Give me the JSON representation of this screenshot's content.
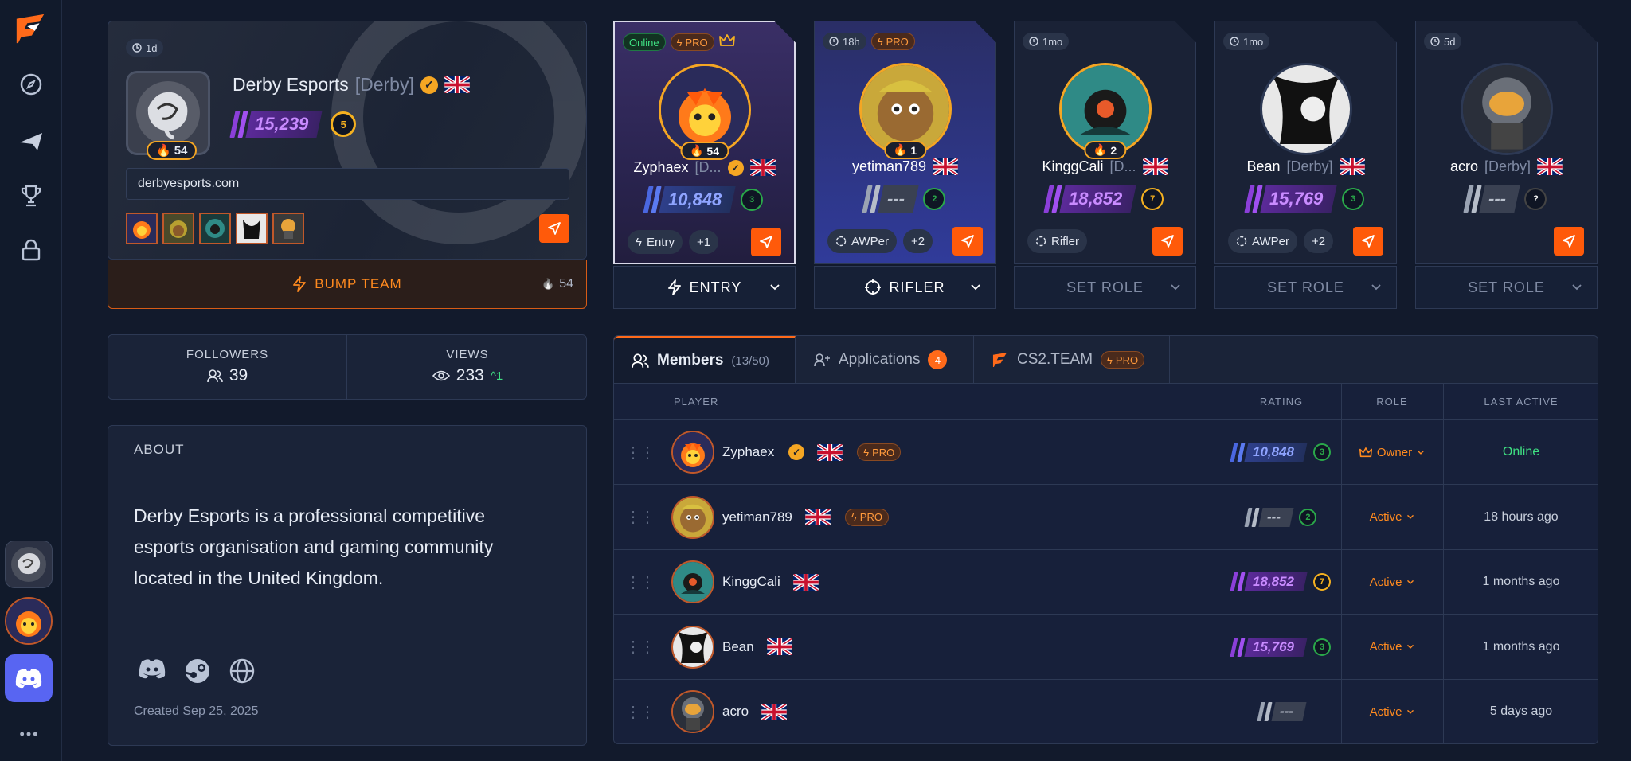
{
  "sidebar": {
    "nav_icons": [
      "logo-icon",
      "compass-icon",
      "megaphone-icon",
      "trophy-icon",
      "lock-icon"
    ],
    "more_label": "•••"
  },
  "team": {
    "age_badge": "1d",
    "name": "Derby Esports",
    "tag": "[Derby]",
    "rating": "15,239",
    "level": "5",
    "fire_count": "54",
    "website": "derbyesports.com",
    "bump_label": "BUMP TEAM",
    "bump_count": "54",
    "followers_label": "FOLLOWERS",
    "followers": "39",
    "views_label": "VIEWS",
    "views": "233",
    "views_delta": "^1"
  },
  "about": {
    "title": "ABOUT",
    "text": "Derby Esports is a professional competitive esports organisation and gaming community located in the United Kingdom.",
    "created": "Created Sep 25, 2025"
  },
  "player_cards": [
    {
      "badge": "Online",
      "pro": "PRO",
      "name": "Zyphaex",
      "tag": "[D...",
      "rating": "10,848",
      "level": "3",
      "fire": "54",
      "role_chip": "Entry",
      "extra": "+1",
      "role": "ENTRY",
      "set": true
    },
    {
      "badge": "18h",
      "pro": "PRO",
      "name": "yetiman789",
      "tag": "",
      "rating": "---",
      "level": "2",
      "fire": "1",
      "role_chip": "AWPer",
      "extra": "+2",
      "role": "RIFLER",
      "set": true
    },
    {
      "badge": "1mo",
      "pro": "",
      "name": "KinggCali",
      "tag": "[D...",
      "rating": "18,852",
      "level": "7",
      "fire": "2",
      "role_chip": "Rifler",
      "extra": "",
      "role": "SET ROLE",
      "set": false
    },
    {
      "badge": "1mo",
      "pro": "",
      "name": "Bean",
      "tag": "[Derby]",
      "rating": "15,769",
      "level": "3",
      "fire": "",
      "role_chip": "AWPer",
      "extra": "+2",
      "role": "SET ROLE",
      "set": false
    },
    {
      "badge": "5d",
      "pro": "",
      "name": "acro",
      "tag": "[Derby]",
      "rating": "---",
      "level": "?",
      "fire": "",
      "role_chip": "",
      "extra": "",
      "role": "SET ROLE",
      "set": false
    }
  ],
  "tabs": {
    "members": "Members",
    "members_count": "(13/50)",
    "applications": "Applications",
    "applications_count": "4",
    "cs2": "CS2.TEAM",
    "cs2_pro": "PRO"
  },
  "table": {
    "headers": {
      "player": "PLAYER",
      "rating": "RATING",
      "role": "ROLE",
      "last_active": "LAST ACTIVE"
    },
    "rows": [
      {
        "name": "Zyphaex",
        "pro": "PRO",
        "rating": "10,848",
        "level": "3",
        "role": "Owner",
        "last": "Online"
      },
      {
        "name": "yetiman789",
        "pro": "PRO",
        "rating": "---",
        "level": "2",
        "role": "Active",
        "last": "18 hours ago"
      },
      {
        "name": "KinggCali",
        "pro": "",
        "rating": "18,852",
        "level": "7",
        "role": "Active",
        "last": "1 months ago"
      },
      {
        "name": "Bean",
        "pro": "",
        "rating": "15,769",
        "level": "3",
        "role": "Active",
        "last": "1 months ago"
      },
      {
        "name": "acro",
        "pro": "",
        "rating": "---",
        "level": "",
        "role": "Active",
        "last": "5 days ago"
      }
    ]
  },
  "colors": {
    "accent": "#ff5a0a",
    "purple": "#8b3fd9",
    "blue": "#4a67e0",
    "online": "#3fe082"
  }
}
